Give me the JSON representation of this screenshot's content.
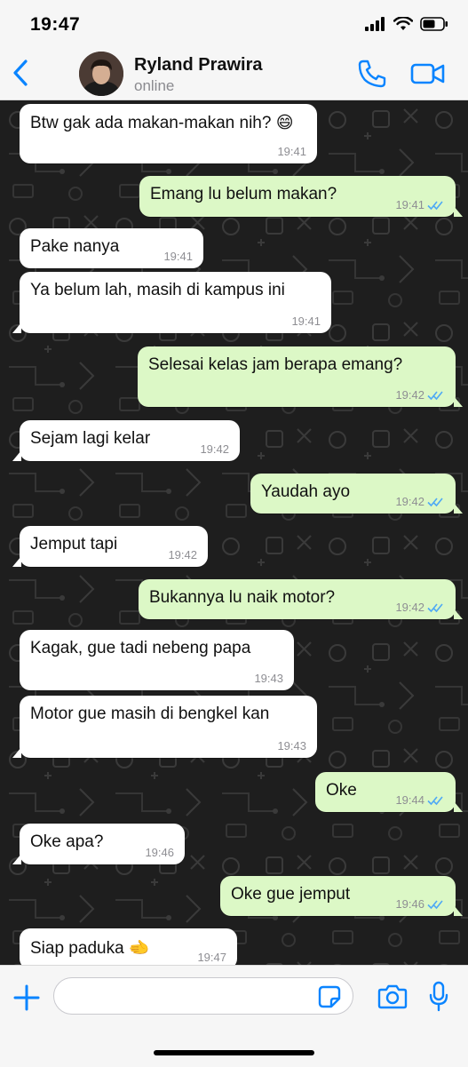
{
  "status_bar": {
    "time": "19:47"
  },
  "header": {
    "contact_name": "Ryland Prawira",
    "contact_status": "online"
  },
  "messages": [
    {
      "dir": "in",
      "text": "Btw gak ada makan-makan nih? 😄",
      "time": "19:41"
    },
    {
      "dir": "out",
      "text": "Emang lu belum makan?",
      "time": "19:41"
    },
    {
      "dir": "in",
      "text": "Pake nanya",
      "time": "19:41"
    },
    {
      "dir": "in",
      "text": "Ya belum lah, masih di kampus ini",
      "time": "19:41"
    },
    {
      "dir": "out",
      "text": "Selesai kelas jam berapa emang?",
      "time": "19:42"
    },
    {
      "dir": "in",
      "text": "Sejam lagi kelar",
      "time": "19:42"
    },
    {
      "dir": "out",
      "text": "Yaudah ayo",
      "time": "19:42"
    },
    {
      "dir": "in",
      "text": "Jemput tapi",
      "time": "19:42"
    },
    {
      "dir": "out",
      "text": "Bukannya lu naik motor?",
      "time": "19:42"
    },
    {
      "dir": "in",
      "text": "Kagak, gue tadi nebeng papa",
      "time": "19:43"
    },
    {
      "dir": "in",
      "text": "Motor gue masih di bengkel kan",
      "time": "19:43"
    },
    {
      "dir": "out",
      "text": "Oke",
      "time": "19:44"
    },
    {
      "dir": "in",
      "text": "Oke apa?",
      "time": "19:46"
    },
    {
      "dir": "out",
      "text": "Oke gue jemput",
      "time": "19:46"
    },
    {
      "dir": "in",
      "text": "Siap paduka 🫲",
      "time": "19:47"
    }
  ],
  "input": {
    "value": "",
    "placeholder": ""
  },
  "colors": {
    "accent": "#0a84ff",
    "outgoing_bubble": "#dcf8c6",
    "incoming_bubble": "#ffffff",
    "read_ticks": "#4fa9f5"
  },
  "icons": [
    "back-chevron-icon",
    "phone-icon",
    "video-icon",
    "plus-icon",
    "sticker-icon",
    "camera-icon",
    "mic-icon",
    "double-check-icon"
  ]
}
